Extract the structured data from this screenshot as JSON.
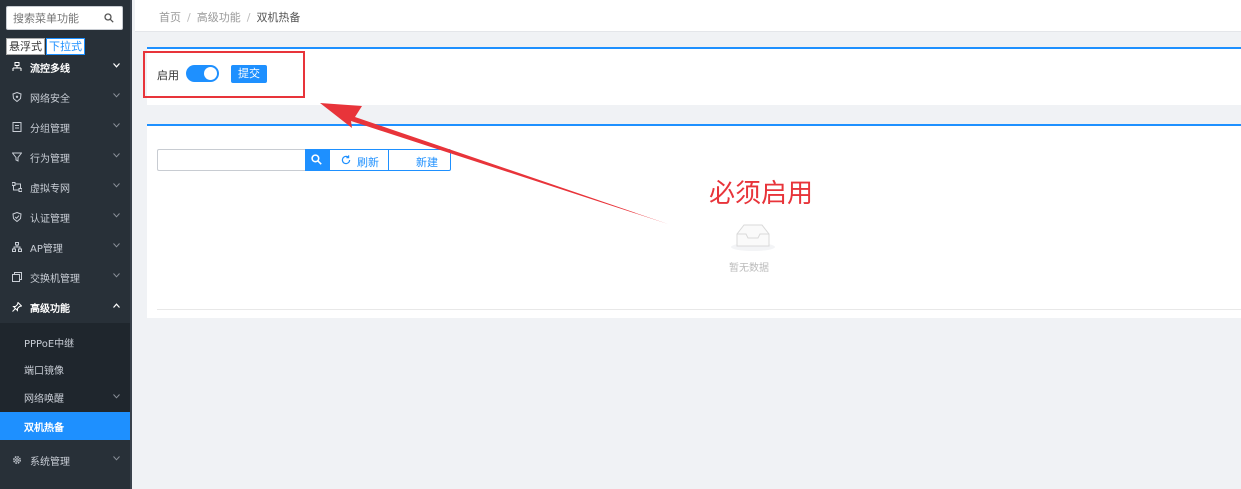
{
  "sidebar": {
    "search_placeholder": "搜索菜单功能",
    "mode_tabs": [
      "悬浮式",
      "下拉式"
    ],
    "menu": [
      {
        "label": "流控多线",
        "icon": "network-lines-icon"
      },
      {
        "label": "网络安全",
        "icon": "shield-icon"
      },
      {
        "label": "分组管理",
        "icon": "group-list-icon"
      },
      {
        "label": "行为管理",
        "icon": "filter-icon"
      },
      {
        "label": "虚拟专网",
        "icon": "vpn-frame-icon"
      },
      {
        "label": "认证管理",
        "icon": "shield-check-icon"
      },
      {
        "label": "AP管理",
        "icon": "hierarchy-icon"
      },
      {
        "label": "交换机管理",
        "icon": "switch-icon"
      },
      {
        "label": "高级功能",
        "icon": "pin-icon"
      }
    ],
    "submenu": [
      "PPPoE中继",
      "端口镜像",
      "网络唤醒",
      "双机热备"
    ],
    "bottom_menu": {
      "label": "系统管理",
      "icon": "gear-icon"
    }
  },
  "breadcrumb": [
    "首页",
    "高级功能",
    "双机热备"
  ],
  "settings": {
    "enable_label": "启用",
    "enabled": true,
    "submit_label": "提交"
  },
  "toolbar": {
    "search_value": "",
    "refresh_label": "刷新",
    "new_label": "新建"
  },
  "table": {
    "empty_text": "暂无数据"
  },
  "annotation": {
    "text": "必须启用",
    "color": "#e8343a"
  },
  "colors": {
    "accent": "#1e90ff",
    "sidebar_bg": "#283038",
    "annotation": "#e8343a"
  }
}
